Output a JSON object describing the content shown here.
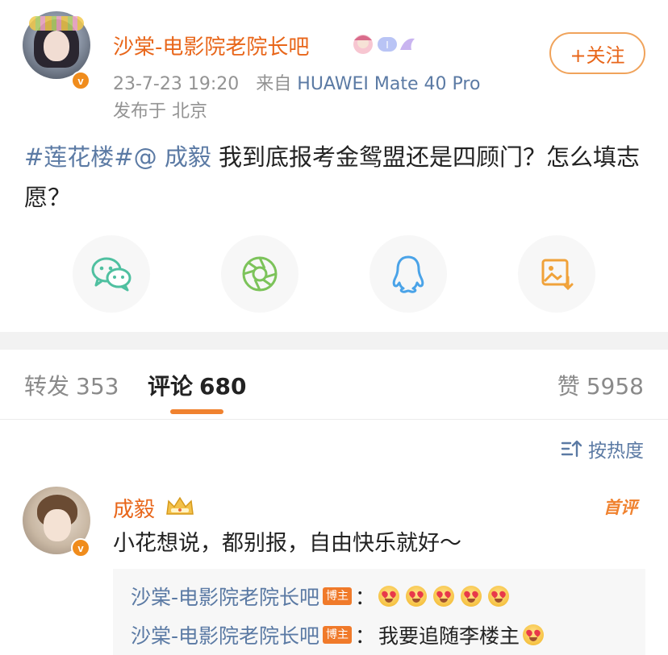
{
  "post": {
    "username": "沙棠-电影院老院长吧",
    "follow_label": "+关注",
    "timestamp": "23-7-23 19:20",
    "source_prefix": "来自",
    "device": "HUAWEI Mate 40 Pro",
    "location": "发布于 北京",
    "text": {
      "topic": "#莲花楼#",
      "mention": "@ 成毅",
      "body": " 我到底报考金鸳盟还是四顾门？怎么填志愿？"
    }
  },
  "share_row": {
    "icons": [
      "wechat-icon",
      "moments-icon",
      "qq-icon",
      "save-image-icon"
    ]
  },
  "tabs": {
    "repost_label": "转发",
    "repost_count": "353",
    "comment_label": "评论",
    "comment_count": "680",
    "like_label": "赞",
    "like_count": "5958"
  },
  "sort_label": "按热度",
  "comment": {
    "username": "成毅",
    "badge": "首评",
    "text": "小花想说，都别报，自由快乐就好～",
    "replies": [
      {
        "user": "沙棠-电影院老院长吧",
        "tag": "博主",
        "colon": "：",
        "text": ""
      },
      {
        "user": "沙棠-电影院老院长吧",
        "tag": "博主",
        "colon": "：",
        "text": "我要追随李楼主"
      }
    ]
  },
  "colors": {
    "brand_orange": "#e8661a",
    "link_blue": "#5b7aa4",
    "tab_underline": "#f0822f"
  }
}
